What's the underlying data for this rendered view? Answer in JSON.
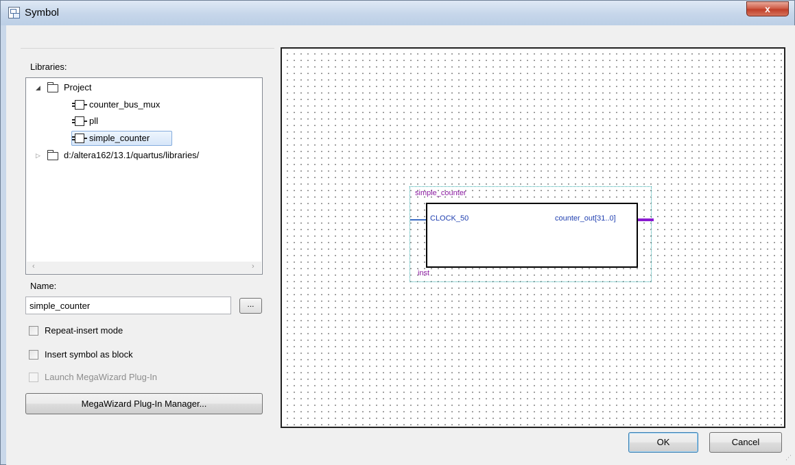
{
  "window": {
    "title": "Symbol",
    "close_label": "x"
  },
  "left": {
    "libraries_label": "Libraries:",
    "tree": {
      "project_label": "Project",
      "items": [
        "counter_bus_mux",
        "pll",
        "simple_counter"
      ],
      "selected": "simple_counter",
      "library_path": "d:/altera162/13.1/quartus/libraries/"
    },
    "name_label": "Name:",
    "name_value": "simple_counter",
    "browse_label": "...",
    "repeat_insert_label": "Repeat-insert mode",
    "insert_block_label": "Insert symbol as block",
    "launch_megawizard_label": "Launch MegaWizard Plug-In",
    "megawizard_manager_label": "MegaWizard Plug-In Manager..."
  },
  "preview": {
    "symbol_name": "simple_counter",
    "input_port": "CLOCK_50",
    "output_port": "counter_out[31..0]",
    "instance": "inst"
  },
  "buttons": {
    "ok": "OK",
    "cancel": "Cancel"
  }
}
